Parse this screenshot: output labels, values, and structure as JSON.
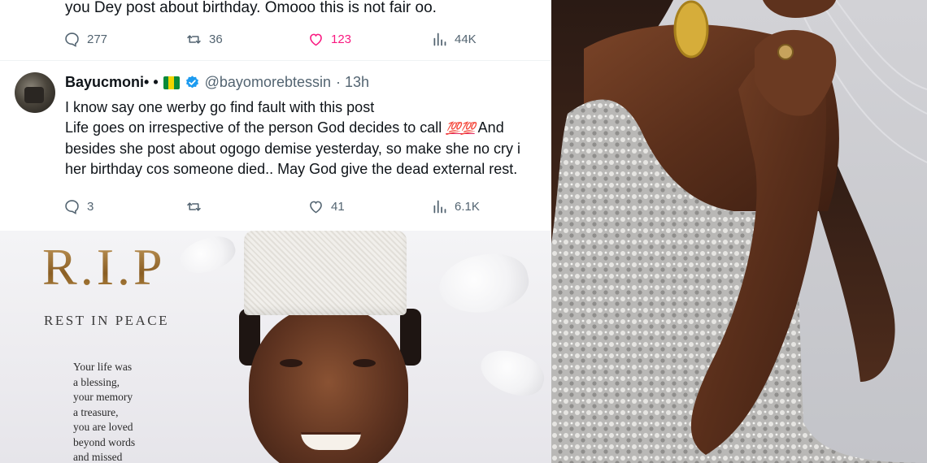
{
  "tweet1": {
    "text_tail": "you Dey post about birthday. Omooo this is not fair oo.",
    "stats": {
      "replies": "277",
      "retweets": "36",
      "likes": "123",
      "views": "44K"
    }
  },
  "tweet2": {
    "display_name": "Bayucmoni• •",
    "handle": "@bayomorebtessin",
    "time": "· 13h",
    "lines": [
      "I know say one werby go find fault with this post",
      "Life goes on irrespective of the person God decides to call",
      "And",
      "besides she post about ogogo demise yesterday, so make she no cry i",
      "her birthday cos someone died.. May God give the dead external rest."
    ],
    "emoji": "💯💯",
    "stats": {
      "replies": "3",
      "likes": "41",
      "views": "6.1K"
    }
  },
  "rip_card": {
    "title": "R.I.P",
    "subtitle": "REST IN PEACE",
    "poem_lines": [
      "Your life was",
      "a blessing,",
      "your memory",
      "a treasure,",
      "you are loved",
      "beyond words",
      "and missed"
    ]
  },
  "icons": {
    "reply": "reply-icon",
    "retweet": "retweet-icon",
    "like": "heart-icon",
    "views": "views-icon",
    "verified": "verified-badge-icon",
    "flag": "flag-icon"
  },
  "colors": {
    "text": "#0f1419",
    "muted": "#536471",
    "like_active": "#f91880",
    "verified": "#1d9bf0",
    "gold": "#a67a3a"
  }
}
